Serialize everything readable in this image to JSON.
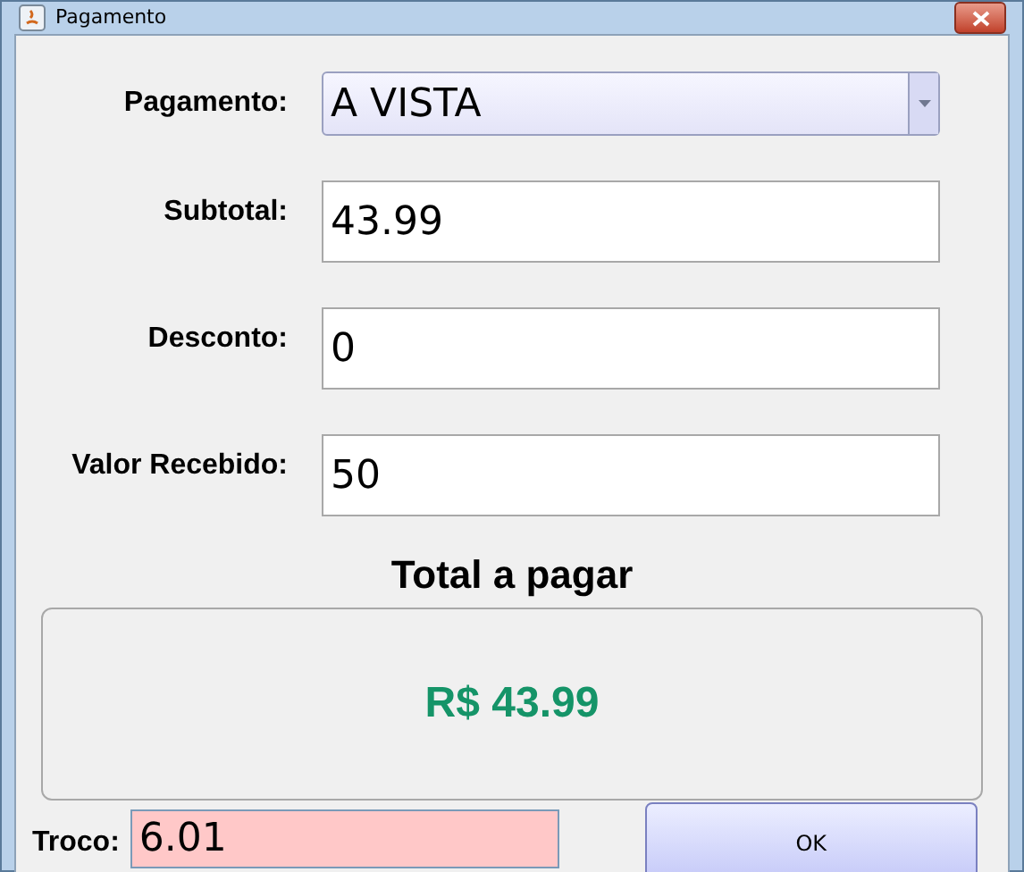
{
  "window": {
    "title": "Pagamento"
  },
  "fields": [
    {
      "kind": "combo",
      "label": "Pagamento:",
      "value": "A VISTA"
    },
    {
      "kind": "text",
      "label": "Subtotal:",
      "value": "43.99"
    },
    {
      "kind": "text",
      "label": "Desconto:",
      "value": "0"
    },
    {
      "kind": "text",
      "label": "Valor Recebido:",
      "value": "50"
    }
  ],
  "total": {
    "title": "Total a pagar",
    "value": "R$ 43.99"
  },
  "troco": {
    "label": "Troco:",
    "value": "6.01"
  },
  "buttons": [
    "OK"
  ]
}
